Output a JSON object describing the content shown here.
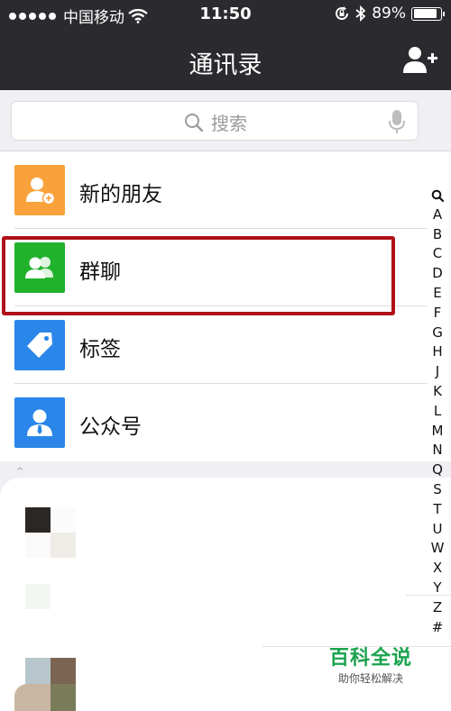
{
  "status_bar": {
    "carrier": "中国移动",
    "time": "11:50",
    "battery_text": "89%",
    "battery_level": 0.89
  },
  "nav": {
    "title": "通讯录"
  },
  "search": {
    "placeholder": "搜索"
  },
  "menu": [
    {
      "label": "新的朋友",
      "icon": "new-friends-icon",
      "color": "#f9a23b"
    },
    {
      "label": "群聊",
      "icon": "group-chat-icon",
      "color": "#21b22c"
    },
    {
      "label": "标签",
      "icon": "tag-icon",
      "color": "#2a86e8"
    },
    {
      "label": "公众号",
      "icon": "official-account-icon",
      "color": "#2a86e8"
    }
  ],
  "index_letters": [
    "A",
    "B",
    "C",
    "D",
    "E",
    "F",
    "G",
    "H",
    "J",
    "K",
    "L",
    "M",
    "N",
    "Q",
    "S",
    "T",
    "U",
    "W",
    "X",
    "Y",
    "Z",
    "#"
  ],
  "watermark": {
    "title": "百科全说",
    "subtitle": "助你轻松解决"
  },
  "colors": {
    "bar_bg": "#2b2b2f",
    "highlight": "#b0101a",
    "watermark_green": "#1ba34e"
  }
}
